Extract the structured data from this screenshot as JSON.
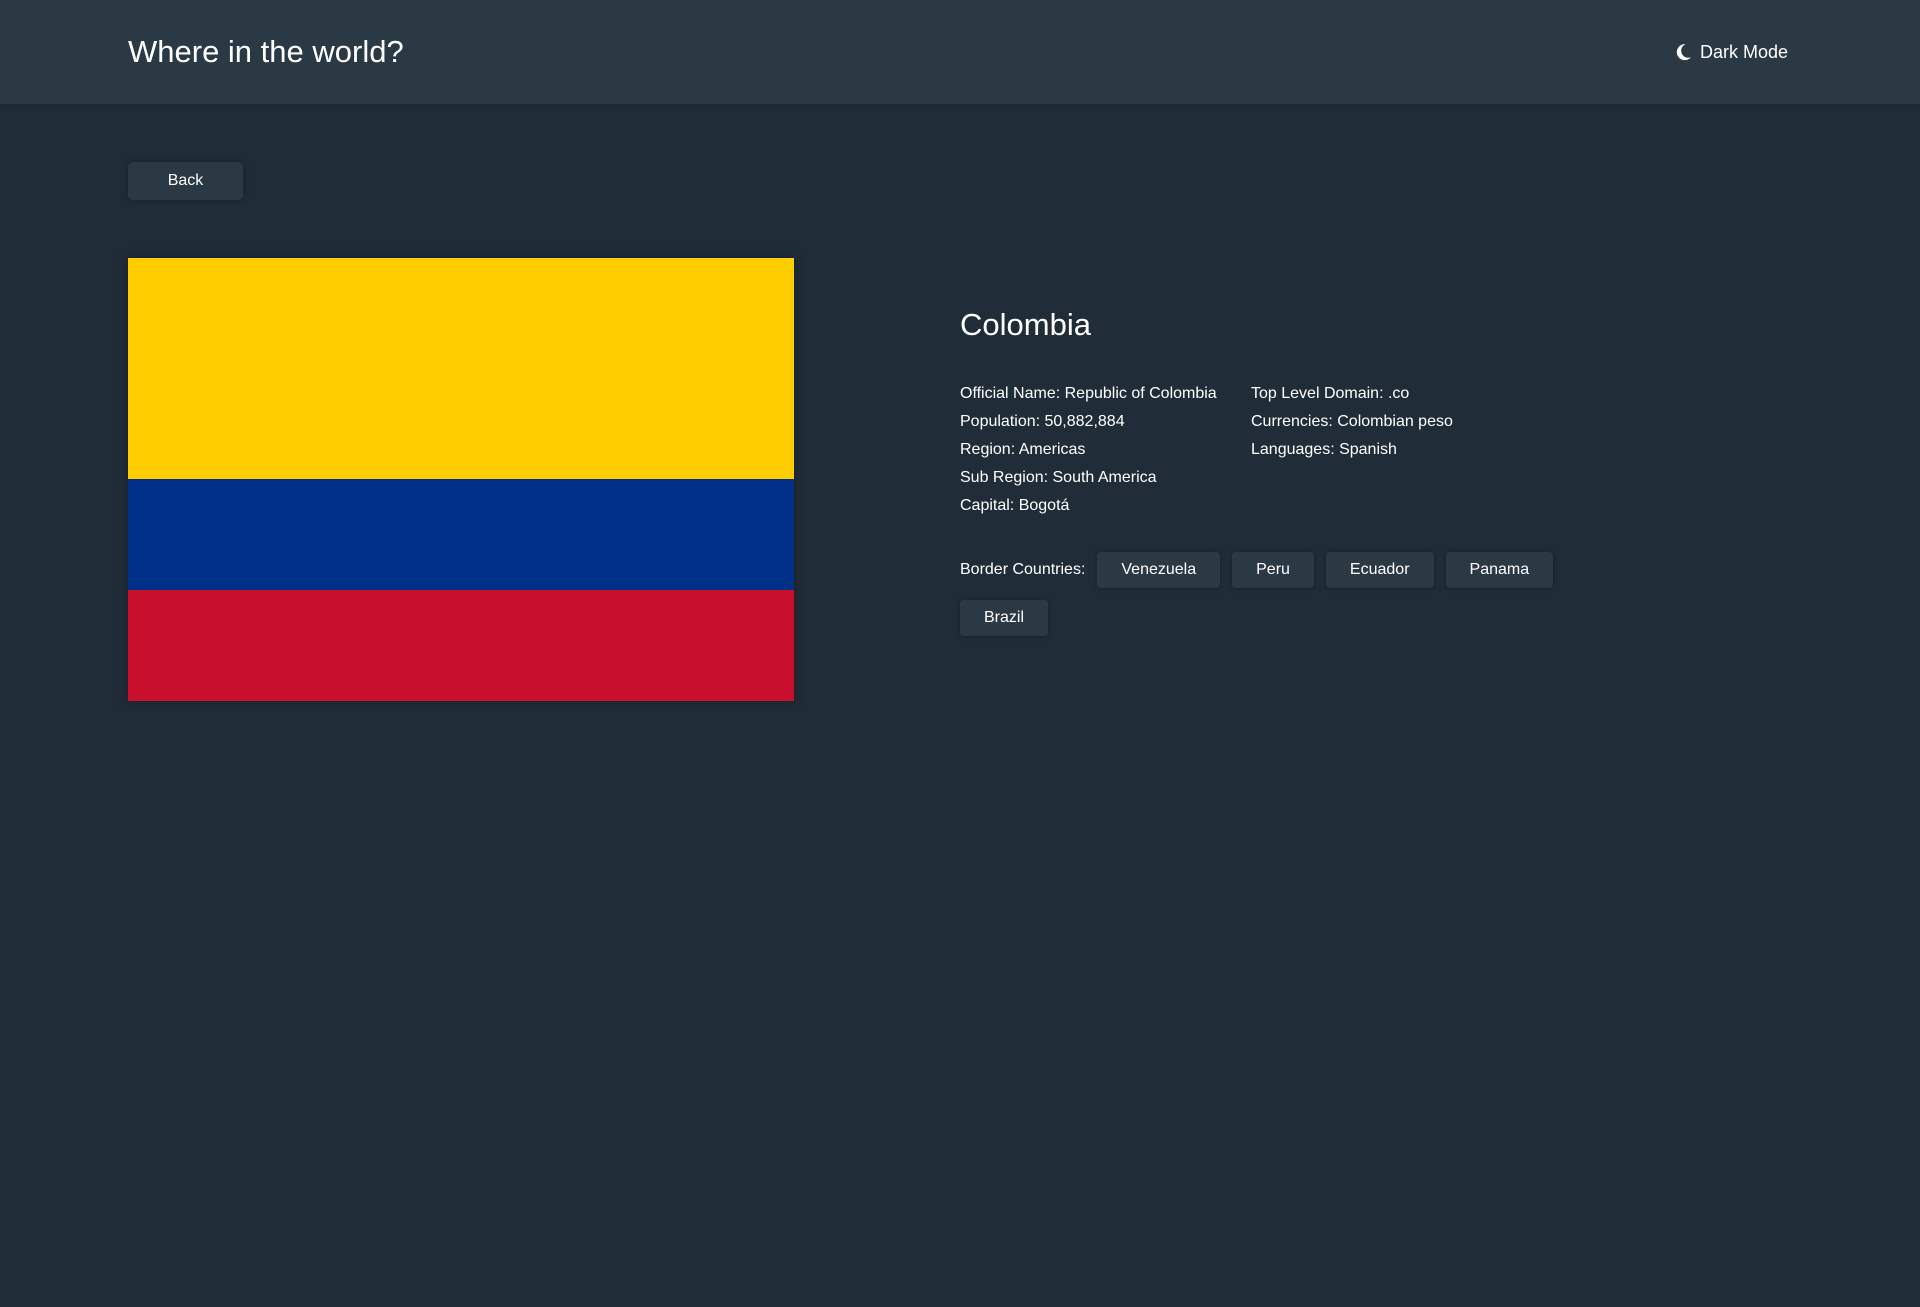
{
  "header": {
    "title": "Where in the world?",
    "dark_mode_label": "Dark Mode",
    "dark_mode_icon": "moon-icon"
  },
  "back_label": "Back",
  "flag": {
    "country": "Colombia",
    "colors": [
      "#ffcd00",
      "#003087",
      "#c8102e"
    ]
  },
  "country": {
    "name": "Colombia",
    "official_name": "Official Name: Republic of Colombia",
    "population": "Population: 50,882,884",
    "region": "Region: Americas",
    "sub_region": "Sub Region: South America",
    "capital": "Capital: Bogotá",
    "top_level_domain": "Top Level Domain: .co",
    "currencies": "Currencies: Colombian peso",
    "languages": "Languages: Spanish"
  },
  "borders": {
    "label": "Border Countries:",
    "countries": [
      "Venezuela",
      "Peru",
      "Ecuador",
      "Panama",
      "Brazil"
    ]
  },
  "theme": {
    "background": "#202c37",
    "elements": "#2b3945",
    "text": "#ffffff"
  }
}
